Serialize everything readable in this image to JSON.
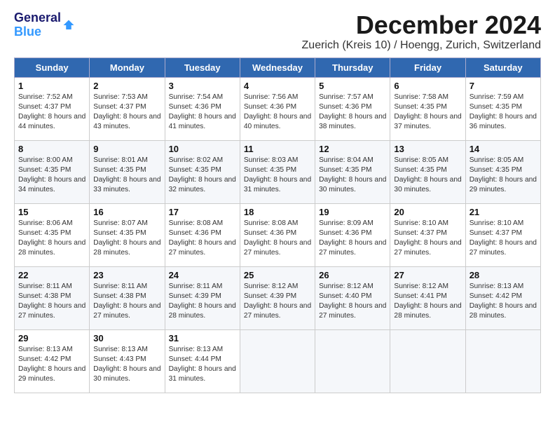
{
  "header": {
    "logo_line1": "General",
    "logo_line2": "Blue",
    "month": "December 2024",
    "location": "Zuerich (Kreis 10) / Hoengg, Zurich, Switzerland"
  },
  "weekdays": [
    "Sunday",
    "Monday",
    "Tuesday",
    "Wednesday",
    "Thursday",
    "Friday",
    "Saturday"
  ],
  "weeks": [
    [
      {
        "day": "1",
        "sunrise": "Sunrise: 7:52 AM",
        "sunset": "Sunset: 4:37 PM",
        "daylight": "Daylight: 8 hours and 44 minutes."
      },
      {
        "day": "2",
        "sunrise": "Sunrise: 7:53 AM",
        "sunset": "Sunset: 4:37 PM",
        "daylight": "Daylight: 8 hours and 43 minutes."
      },
      {
        "day": "3",
        "sunrise": "Sunrise: 7:54 AM",
        "sunset": "Sunset: 4:36 PM",
        "daylight": "Daylight: 8 hours and 41 minutes."
      },
      {
        "day": "4",
        "sunrise": "Sunrise: 7:56 AM",
        "sunset": "Sunset: 4:36 PM",
        "daylight": "Daylight: 8 hours and 40 minutes."
      },
      {
        "day": "5",
        "sunrise": "Sunrise: 7:57 AM",
        "sunset": "Sunset: 4:36 PM",
        "daylight": "Daylight: 8 hours and 38 minutes."
      },
      {
        "day": "6",
        "sunrise": "Sunrise: 7:58 AM",
        "sunset": "Sunset: 4:35 PM",
        "daylight": "Daylight: 8 hours and 37 minutes."
      },
      {
        "day": "7",
        "sunrise": "Sunrise: 7:59 AM",
        "sunset": "Sunset: 4:35 PM",
        "daylight": "Daylight: 8 hours and 36 minutes."
      }
    ],
    [
      {
        "day": "8",
        "sunrise": "Sunrise: 8:00 AM",
        "sunset": "Sunset: 4:35 PM",
        "daylight": "Daylight: 8 hours and 34 minutes."
      },
      {
        "day": "9",
        "sunrise": "Sunrise: 8:01 AM",
        "sunset": "Sunset: 4:35 PM",
        "daylight": "Daylight: 8 hours and 33 minutes."
      },
      {
        "day": "10",
        "sunrise": "Sunrise: 8:02 AM",
        "sunset": "Sunset: 4:35 PM",
        "daylight": "Daylight: 8 hours and 32 minutes."
      },
      {
        "day": "11",
        "sunrise": "Sunrise: 8:03 AM",
        "sunset": "Sunset: 4:35 PM",
        "daylight": "Daylight: 8 hours and 31 minutes."
      },
      {
        "day": "12",
        "sunrise": "Sunrise: 8:04 AM",
        "sunset": "Sunset: 4:35 PM",
        "daylight": "Daylight: 8 hours and 30 minutes."
      },
      {
        "day": "13",
        "sunrise": "Sunrise: 8:05 AM",
        "sunset": "Sunset: 4:35 PM",
        "daylight": "Daylight: 8 hours and 30 minutes."
      },
      {
        "day": "14",
        "sunrise": "Sunrise: 8:05 AM",
        "sunset": "Sunset: 4:35 PM",
        "daylight": "Daylight: 8 hours and 29 minutes."
      }
    ],
    [
      {
        "day": "15",
        "sunrise": "Sunrise: 8:06 AM",
        "sunset": "Sunset: 4:35 PM",
        "daylight": "Daylight: 8 hours and 28 minutes."
      },
      {
        "day": "16",
        "sunrise": "Sunrise: 8:07 AM",
        "sunset": "Sunset: 4:35 PM",
        "daylight": "Daylight: 8 hours and 28 minutes."
      },
      {
        "day": "17",
        "sunrise": "Sunrise: 8:08 AM",
        "sunset": "Sunset: 4:36 PM",
        "daylight": "Daylight: 8 hours and 27 minutes."
      },
      {
        "day": "18",
        "sunrise": "Sunrise: 8:08 AM",
        "sunset": "Sunset: 4:36 PM",
        "daylight": "Daylight: 8 hours and 27 minutes."
      },
      {
        "day": "19",
        "sunrise": "Sunrise: 8:09 AM",
        "sunset": "Sunset: 4:36 PM",
        "daylight": "Daylight: 8 hours and 27 minutes."
      },
      {
        "day": "20",
        "sunrise": "Sunrise: 8:10 AM",
        "sunset": "Sunset: 4:37 PM",
        "daylight": "Daylight: 8 hours and 27 minutes."
      },
      {
        "day": "21",
        "sunrise": "Sunrise: 8:10 AM",
        "sunset": "Sunset: 4:37 PM",
        "daylight": "Daylight: 8 hours and 27 minutes."
      }
    ],
    [
      {
        "day": "22",
        "sunrise": "Sunrise: 8:11 AM",
        "sunset": "Sunset: 4:38 PM",
        "daylight": "Daylight: 8 hours and 27 minutes."
      },
      {
        "day": "23",
        "sunrise": "Sunrise: 8:11 AM",
        "sunset": "Sunset: 4:38 PM",
        "daylight": "Daylight: 8 hours and 27 minutes."
      },
      {
        "day": "24",
        "sunrise": "Sunrise: 8:11 AM",
        "sunset": "Sunset: 4:39 PM",
        "daylight": "Daylight: 8 hours and 28 minutes."
      },
      {
        "day": "25",
        "sunrise": "Sunrise: 8:12 AM",
        "sunset": "Sunset: 4:39 PM",
        "daylight": "Daylight: 8 hours and 27 minutes."
      },
      {
        "day": "26",
        "sunrise": "Sunrise: 8:12 AM",
        "sunset": "Sunset: 4:40 PM",
        "daylight": "Daylight: 8 hours and 27 minutes."
      },
      {
        "day": "27",
        "sunrise": "Sunrise: 8:12 AM",
        "sunset": "Sunset: 4:41 PM",
        "daylight": "Daylight: 8 hours and 28 minutes."
      },
      {
        "day": "28",
        "sunrise": "Sunrise: 8:13 AM",
        "sunset": "Sunset: 4:42 PM",
        "daylight": "Daylight: 8 hours and 28 minutes."
      }
    ],
    [
      {
        "day": "29",
        "sunrise": "Sunrise: 8:13 AM",
        "sunset": "Sunset: 4:42 PM",
        "daylight": "Daylight: 8 hours and 29 minutes."
      },
      {
        "day": "30",
        "sunrise": "Sunrise: 8:13 AM",
        "sunset": "Sunset: 4:43 PM",
        "daylight": "Daylight: 8 hours and 30 minutes."
      },
      {
        "day": "31",
        "sunrise": "Sunrise: 8:13 AM",
        "sunset": "Sunset: 4:44 PM",
        "daylight": "Daylight: 8 hours and 31 minutes."
      },
      null,
      null,
      null,
      null
    ]
  ]
}
